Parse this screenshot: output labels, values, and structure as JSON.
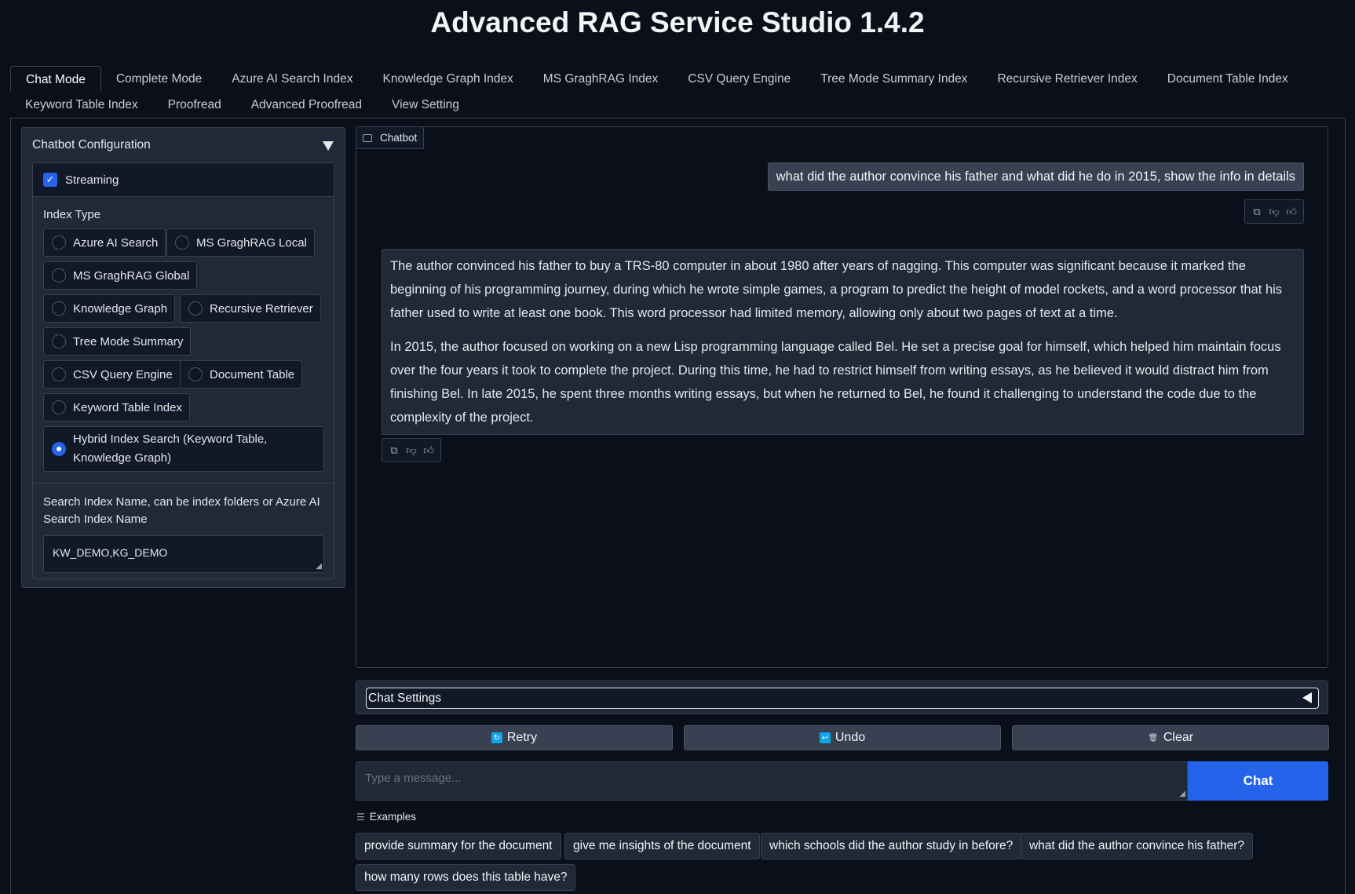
{
  "app": {
    "title": "Advanced RAG Service Studio 1.4.2"
  },
  "tabs": [
    {
      "label": "Chat Mode"
    },
    {
      "label": "Complete Mode"
    },
    {
      "label": "Azure AI Search Index"
    },
    {
      "label": "Knowledge Graph Index"
    },
    {
      "label": "MS GraghRAG Index"
    },
    {
      "label": "CSV Query Engine"
    },
    {
      "label": "Tree Mode Summary Index"
    },
    {
      "label": "Recursive Retriever Index"
    },
    {
      "label": "Document Table Index"
    },
    {
      "label": "Keyword Table Index"
    },
    {
      "label": "Proofread"
    },
    {
      "label": "Advanced Proofread"
    },
    {
      "label": "View Setting"
    }
  ],
  "config": {
    "header": "Chatbot Configuration",
    "streaming_label": "Streaming",
    "index_type_label": "Index Type",
    "index_options": [
      {
        "label": "Azure AI Search"
      },
      {
        "label": "MS GraghRAG Local"
      },
      {
        "label": "MS GraghRAG Global"
      },
      {
        "label": "Knowledge Graph"
      },
      {
        "label": "Recursive Retriever"
      },
      {
        "label": "Tree Mode Summary"
      },
      {
        "label": "CSV Query Engine"
      },
      {
        "label": "Document Table"
      },
      {
        "label": "Keyword Table Index"
      },
      {
        "label": "Hybrid Index Search (Keyword Table, Knowledge Graph)"
      }
    ],
    "selected_index": "Hybrid Index Search (Keyword Table, Knowledge Graph)",
    "search_index_label": "Search Index Name, can be index folders or Azure AI Search Index Name",
    "search_index_value": "KW_DEMO,KG_DEMO"
  },
  "chatbot": {
    "label": "Chatbot",
    "user_message": "what did the author convince his father and what did he do in 2015, show the info in details",
    "bot_paragraphs": [
      "The author convinced his father to buy a TRS-80 computer in about 1980 after years of nagging. This computer was significant because it marked the beginning of his programming journey, during which he wrote simple games, a program to predict the height of model rockets, and a word processor that his father used to write at least one book. This word processor had limited memory, allowing only about two pages of text at a time.",
      "In 2015, the author focused on working on a new Lisp programming language called Bel. He set a precise goal for himself, which helped him maintain focus over the four years it took to complete the project. During this time, he had to restrict himself from writing essays, as he believed it would distract him from finishing Bel. In late 2015, he spent three months writing essays, but when he returned to Bel, he found it challenging to understand the code due to the complexity of the project."
    ]
  },
  "chat_settings": {
    "label": "Chat Settings"
  },
  "buttons": {
    "retry": "Retry",
    "undo": "Undo",
    "clear": "Clear",
    "chat": "Chat"
  },
  "input": {
    "placeholder": "Type a message..."
  },
  "examples": {
    "label": "Examples",
    "items": [
      "provide summary for the document",
      "give me insights of the document",
      "which schools did the author study in before?",
      "what did the author convince his father?",
      "how many rows does this table have?"
    ]
  },
  "colors": {
    "accent": "#2563eb",
    "background": "#0b0f19",
    "panel": "#1f2937"
  }
}
